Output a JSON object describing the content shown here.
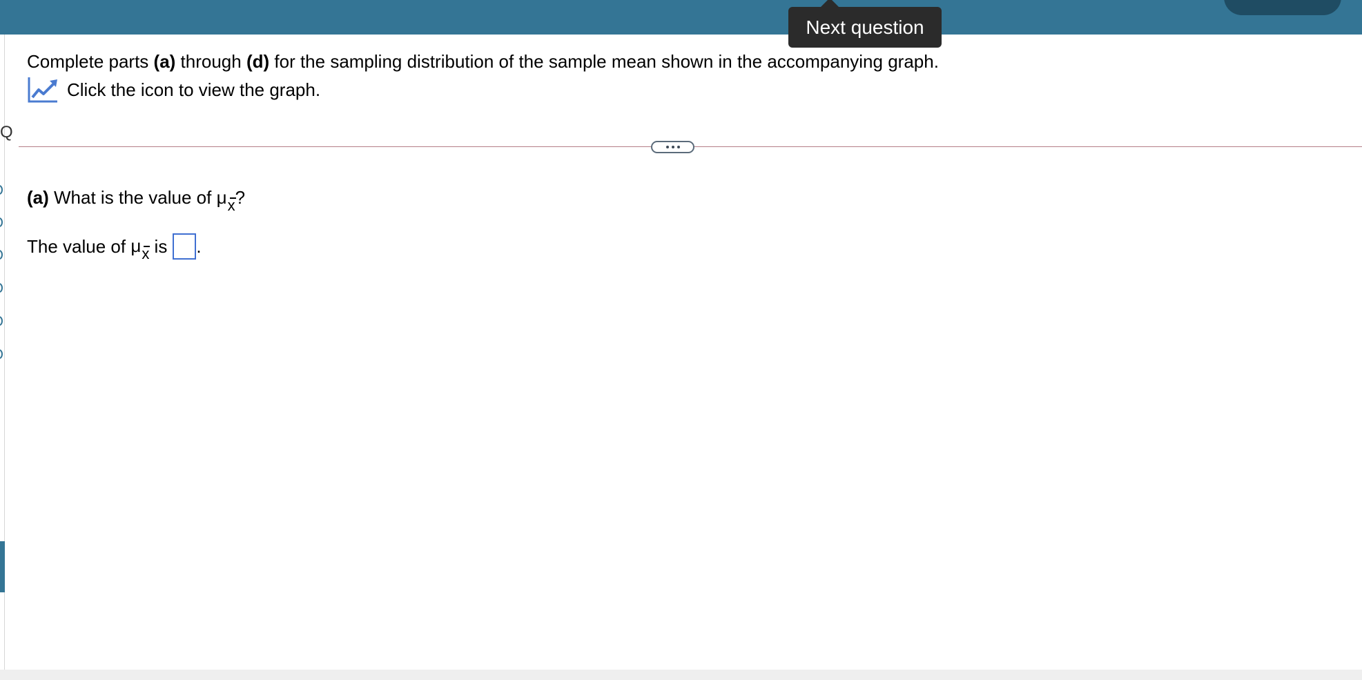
{
  "header": {
    "tooltip": "Next question"
  },
  "question": {
    "intro_prefix": "Complete parts ",
    "intro_a": "(a)",
    "intro_mid": " through ",
    "intro_d": "(d)",
    "intro_suffix": " for the sampling distribution of the sample mean shown in the accompanying graph.",
    "graph_link": "Click the icon to view the graph."
  },
  "part_a": {
    "label": "(a)",
    "question_prefix": "What is the value of ",
    "symbol": "μ",
    "subscript": "x",
    "question_suffix": "?",
    "answer_prefix": "The value of ",
    "answer_is": "is",
    "answer_end": ".",
    "answer_value": ""
  },
  "colors": {
    "header_bg": "#347595",
    "tooltip_bg": "#2b2b2b",
    "input_border": "#3f6fd1",
    "divider": "#b47d86"
  },
  "icons": {
    "graph": "line-chart-icon",
    "expander": "ellipsis-icon"
  }
}
